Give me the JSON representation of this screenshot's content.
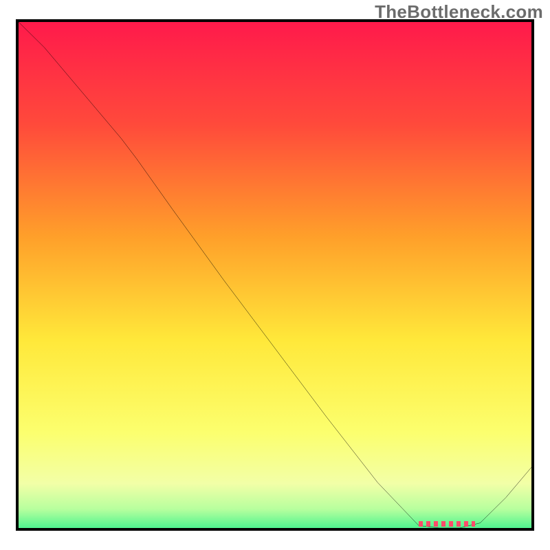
{
  "watermark": "TheBottleneck.com",
  "chart_data": {
    "type": "line",
    "title": "",
    "xlabel": "",
    "ylabel": "",
    "xlim": [
      0,
      100
    ],
    "ylim": [
      0,
      100
    ],
    "x": [
      0,
      5,
      10,
      15,
      20,
      23,
      30,
      40,
      50,
      60,
      70,
      78,
      82,
      86,
      90,
      95,
      100
    ],
    "values": [
      100,
      95,
      89,
      83,
      77,
      73,
      63,
      49,
      35.5,
      22,
      9,
      0.5,
      0,
      0,
      1,
      6,
      12
    ],
    "minimum_segment": {
      "x_start": 78,
      "x_end": 89,
      "y": 0.5
    },
    "gradient_stops": [
      {
        "pos": 0.0,
        "color": "#ff1a4b"
      },
      {
        "pos": 0.2,
        "color": "#ff4a3b"
      },
      {
        "pos": 0.42,
        "color": "#ffa02a"
      },
      {
        "pos": 0.62,
        "color": "#ffe83a"
      },
      {
        "pos": 0.8,
        "color": "#fcff6e"
      },
      {
        "pos": 0.9,
        "color": "#f2ffa7"
      },
      {
        "pos": 0.95,
        "color": "#b7ff9e"
      },
      {
        "pos": 1.0,
        "color": "#29f08a"
      }
    ]
  }
}
